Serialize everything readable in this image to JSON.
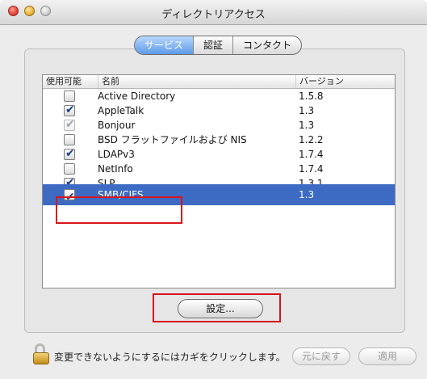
{
  "window": {
    "title": "ディレクトリアクセス"
  },
  "tabs": [
    {
      "label": "サービス",
      "active": true
    },
    {
      "label": "認証",
      "active": false
    },
    {
      "label": "コンタクト",
      "active": false
    }
  ],
  "list": {
    "columns": {
      "enabled": "使用可能",
      "name": "名前",
      "version": "バージョン"
    },
    "rows": [
      {
        "name": "Active Directory",
        "version": "1.5.8",
        "checked": false,
        "dim": false
      },
      {
        "name": "AppleTalk",
        "version": "1.3",
        "checked": true,
        "dim": false
      },
      {
        "name": "Bonjour",
        "version": "1.3",
        "checked": true,
        "dim": true
      },
      {
        "name": "BSD フラットファイルおよび NIS",
        "version": "1.2.2",
        "checked": false,
        "dim": false
      },
      {
        "name": "LDAPv3",
        "version": "1.7.4",
        "checked": true,
        "dim": false
      },
      {
        "name": "NetInfo",
        "version": "1.7.4",
        "checked": false,
        "dim": false
      },
      {
        "name": "SLP",
        "version": "1.3.1",
        "checked": true,
        "dim": false
      },
      {
        "name": "SMB/CIFS",
        "version": "1.3",
        "checked": true,
        "dim": false,
        "selected": true
      }
    ]
  },
  "buttons": {
    "configure": "設定...",
    "revert": "元に戻す",
    "apply": "適用"
  },
  "lock": {
    "message": "変更できないようにするにはカギをクリックします。"
  },
  "colors": {
    "selection": "#3d6bc4",
    "highlight_box": "#d8141c",
    "tab_active": "#5e9ae8"
  }
}
